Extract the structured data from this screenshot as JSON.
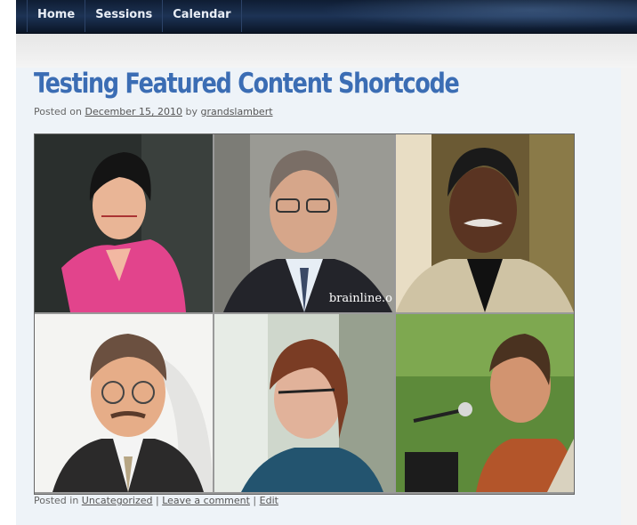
{
  "nav": {
    "items": [
      {
        "label": "Home"
      },
      {
        "label": "Sessions"
      },
      {
        "label": "Calendar"
      }
    ]
  },
  "post": {
    "title": "Testing Featured Content Shortcode",
    "meta": {
      "posted_on_prefix": "Posted on ",
      "date": "December 15, 2010",
      "by_prefix": " by ",
      "author": "grandslambert"
    },
    "photos": [
      {
        "label": "woman-pink-shirt"
      },
      {
        "label": "man-glasses-suit",
        "watermark": "brainline.o"
      },
      {
        "label": "older-man-mustache"
      },
      {
        "label": "man-round-glasses"
      },
      {
        "label": "woman-short-hair"
      },
      {
        "label": "man-singing-microphone"
      }
    ],
    "footer": {
      "posted_in_prefix": "Posted in ",
      "category": "Uncategorized",
      "sep1": " | ",
      "comment": "Leave a comment",
      "sep2": " | ",
      "edit": "Edit"
    }
  },
  "colors": {
    "nav_bg": "#13243f",
    "title_blue": "#3b6db4",
    "post_bg": "#eef3f8"
  }
}
